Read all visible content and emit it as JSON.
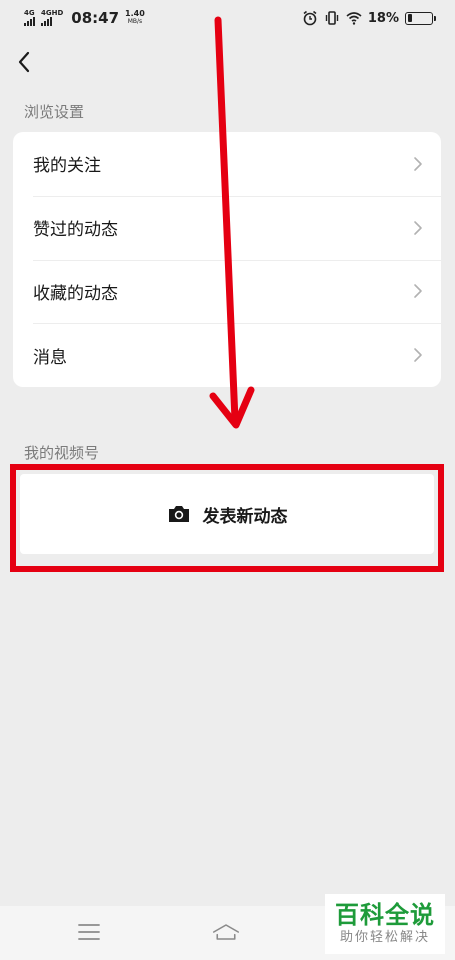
{
  "status_bar": {
    "net1": "4G",
    "net2": "4GHD",
    "time": "08:47",
    "speed_value": "1.40",
    "speed_unit": "MB/s",
    "battery_percent": "18%",
    "battery_level": 0.18
  },
  "browse_settings": {
    "title": "浏览设置",
    "items": [
      {
        "label": "我的关注"
      },
      {
        "label": "赞过的动态"
      },
      {
        "label": "收藏的动态"
      },
      {
        "label": "消息"
      }
    ]
  },
  "channels": {
    "title": "我的视频号",
    "post_label": "发表新动态"
  },
  "annotation": {
    "color": "#e50012"
  },
  "watermark": {
    "title": "百科全说",
    "subtitle": "助你轻松解决",
    "color": "#1e9b3a"
  }
}
